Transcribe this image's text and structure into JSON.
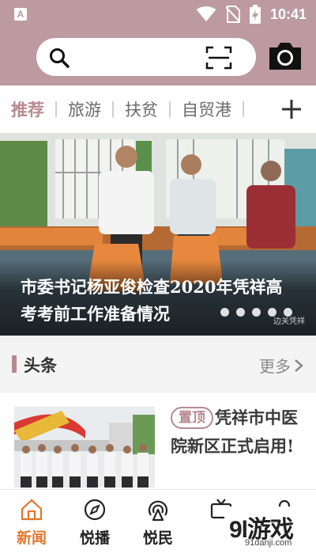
{
  "status_bar": {
    "app_badge": "A",
    "time": "10:41",
    "icons": [
      "wifi-icon",
      "no-sim-icon",
      "battery-charging-icon"
    ]
  },
  "header": {
    "search": {
      "placeholder": "",
      "icon": "search-icon"
    },
    "scan_icon": "scan-icon",
    "camera_icon": "camera-icon"
  },
  "tabs": [
    {
      "label": "推荐",
      "active": true
    },
    {
      "label": "旅游",
      "active": false
    },
    {
      "label": "扶贫",
      "active": false
    },
    {
      "label": "自贸港",
      "active": false
    }
  ],
  "add_tab_icon": "plus-icon",
  "banner": {
    "title": "市委书记杨亚俊检查2020年凭祥高考考前工作准备情况",
    "slide_count": 5,
    "watermark": "边关凭祥"
  },
  "section": {
    "title": "头条",
    "more_label": "更多"
  },
  "news": [
    {
      "badge": "置顶",
      "title": "凭祥市中医院新区正式启用!"
    }
  ],
  "bottom_nav": [
    {
      "label": "新闻",
      "icon": "home-icon",
      "active": true
    },
    {
      "label": "悦播",
      "icon": "compass-icon",
      "active": false
    },
    {
      "label": "悦民",
      "icon": "broadcast-icon",
      "active": false
    },
    {
      "label": "",
      "icon": "tv-icon",
      "active": false
    },
    {
      "label": "",
      "icon": "profile-icon",
      "active": false
    }
  ],
  "watermark_logo": {
    "main": "9l游戏",
    "url": "91danji.com"
  },
  "colors": {
    "header_bg": "#bc9a9f",
    "accent": "#b78a8f",
    "nav_active": "#e2762f"
  }
}
